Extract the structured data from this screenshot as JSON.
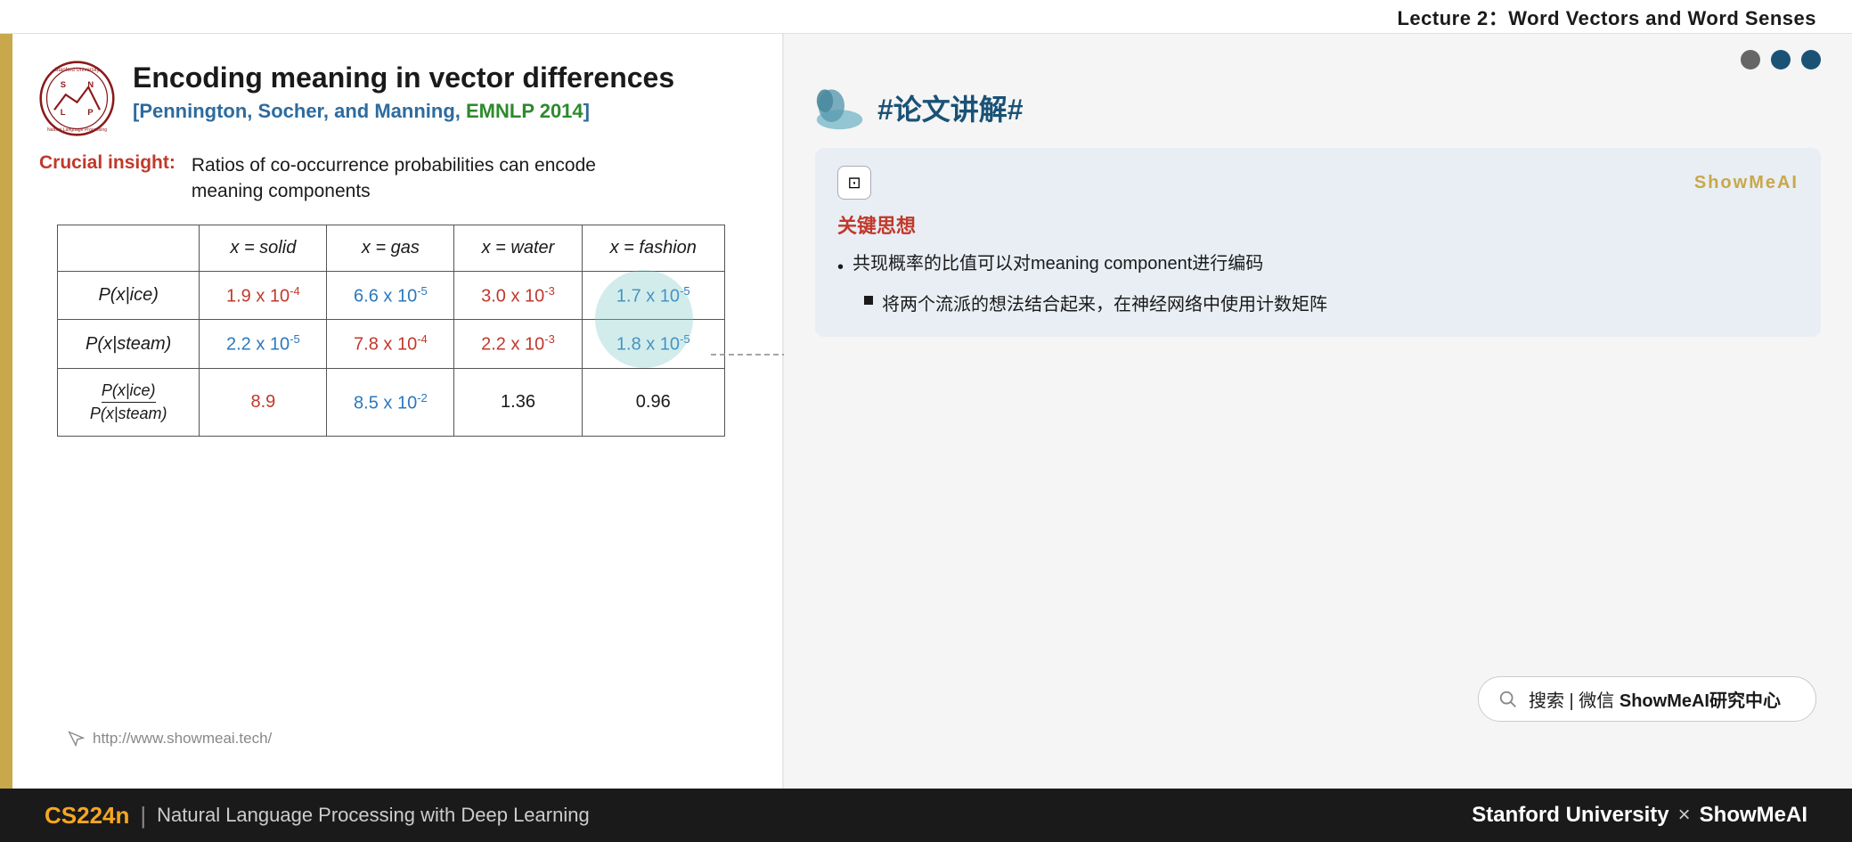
{
  "lecture": {
    "title": "Lecture 2：Word Vectors and Word Senses"
  },
  "slide": {
    "main_title": "Encoding meaning in vector differences",
    "subtitle_part1": "[Pennington, Socher, and Manning, ",
    "subtitle_emnlp": "EMNLP 2014",
    "subtitle_part2": "]",
    "crucial_label": "Crucial insight:",
    "crucial_text": "Ratios of co-occurrence probabilities can encode\nmeaning components",
    "url": "http://www.showmeai.tech/",
    "table": {
      "col_headers": [
        "x = solid",
        "x = gas",
        "x = water",
        "x = fashion"
      ],
      "rows": [
        {
          "row_header": "P(x|ice)",
          "values": [
            {
              "text": "1.9 x 10",
              "sup": "-4",
              "class": "val-red"
            },
            {
              "text": "6.6 x 10",
              "sup": "-5",
              "class": "val-blue"
            },
            {
              "text": "3.0 x 10",
              "sup": "-3",
              "class": "val-red"
            },
            {
              "text": "1.7 x 10",
              "sup": "-5",
              "class": "val-blue"
            }
          ]
        },
        {
          "row_header": "P(x|steam)",
          "values": [
            {
              "text": "2.2 x 10",
              "sup": "-5",
              "class": "val-blue"
            },
            {
              "text": "7.8 x 10",
              "sup": "-4",
              "class": "val-red"
            },
            {
              "text": "2.2 x 10",
              "sup": "-3",
              "class": "val-red"
            },
            {
              "text": "1.8 x 10",
              "sup": "-5",
              "class": "val-blue"
            }
          ]
        },
        {
          "row_header_fraction": {
            "num": "P(x|ice)",
            "den": "P(x|steam)"
          },
          "values": [
            {
              "text": "8.9",
              "class": "val-red"
            },
            {
              "text": "8.5 x 10",
              "sup": "-2",
              "class": "val-blue"
            },
            {
              "text": "1.36",
              "class": "val-dark"
            },
            {
              "text": "0.96",
              "class": "val-dark"
            }
          ]
        }
      ]
    }
  },
  "annotation": {
    "hashtag": "#论文讲解#",
    "card": {
      "brand": "ShowMeAI",
      "section_title": "关键思想",
      "bullet": "共现概率的比值可以对meaning component进行编码",
      "sub_bullet": "将两个流派的想法结合起来，在神经网络中使用计数矩阵"
    },
    "search_bar": {
      "icon": "🔍",
      "text": "搜索 | 微信 ShowMeAI研究中心"
    }
  },
  "bottom_bar": {
    "course_code": "CS224n",
    "separator": "|",
    "course_name": "Natural Language Processing with Deep Learning",
    "right_text": "Stanford University × ShowMeAI"
  },
  "nav_dots": [
    {
      "active": false
    },
    {
      "active": true
    },
    {
      "active": true
    }
  ]
}
